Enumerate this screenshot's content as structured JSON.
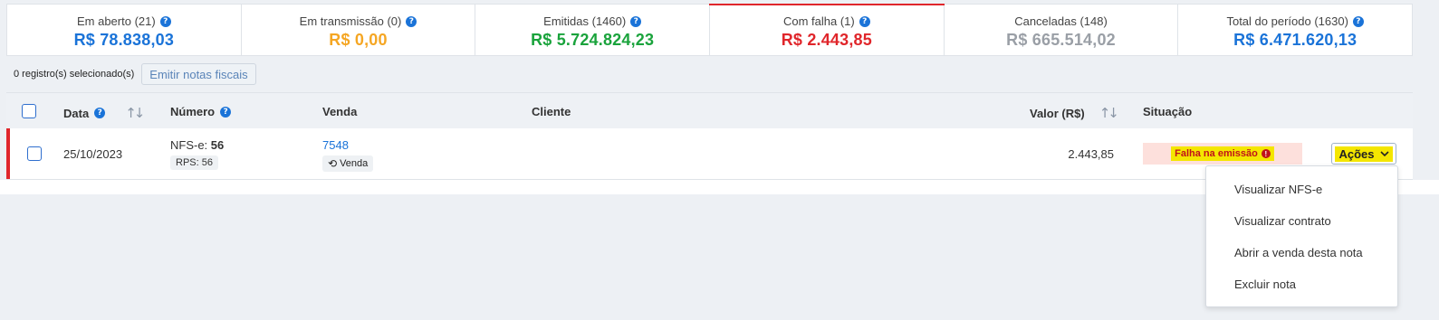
{
  "summary": [
    {
      "title": "Em aberto (21)",
      "value": "R$ 78.838,03",
      "color": "#1a73d8",
      "help": true,
      "active": false
    },
    {
      "title": "Em transmissão (0)",
      "value": "R$ 0,00",
      "color": "#f5a623",
      "help": true,
      "active": false
    },
    {
      "title": "Emitidas (1460)",
      "value": "R$ 5.724.824,23",
      "color": "#1aa33c",
      "help": true,
      "active": false
    },
    {
      "title": "Com falha (1)",
      "value": "R$ 2.443,85",
      "color": "#e0262b",
      "help": true,
      "active": true
    },
    {
      "title": "Canceladas (148)",
      "value": "R$ 665.514,02",
      "color": "#9a9fa6",
      "help": false,
      "active": false
    },
    {
      "title": "Total do período (1630)",
      "value": "R$ 6.471.620,13",
      "color": "#1a73d8",
      "help": true,
      "active": false
    }
  ],
  "toolbar": {
    "selected_count": "0 registro(s) selecionado(s)",
    "emit_label": "Emitir notas fiscais"
  },
  "table": {
    "headers": {
      "data": "Data",
      "numero": "Número",
      "venda": "Venda",
      "cliente": "Cliente",
      "valor": "Valor (R$)",
      "situacao": "Situação"
    },
    "rows": [
      {
        "data": "25/10/2023",
        "numero_prefix": "NFS-e:",
        "numero_value": "56",
        "rps": "RPS: 56",
        "venda_id": "7548",
        "venda_badge": "Venda",
        "cliente": "",
        "valor": "2.443,85",
        "situacao": "Falha na emissão",
        "acoes_label": "Ações"
      }
    ]
  },
  "dropdown": {
    "items": [
      "Visualizar NFS-e",
      "Visualizar contrato",
      "Abrir a venda desta nota",
      "Excluir nota"
    ]
  }
}
